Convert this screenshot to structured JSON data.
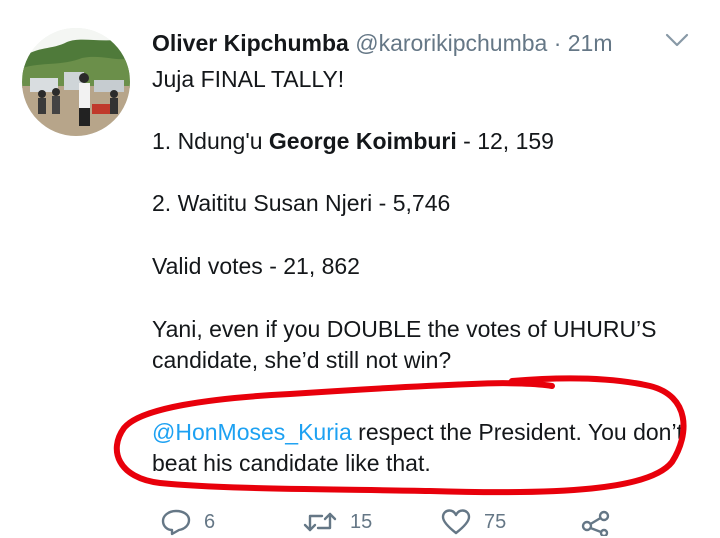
{
  "tweet": {
    "author_name": "Oliver Kipchumba",
    "handle": "@karorikipchumba",
    "separator": "·",
    "time": "21m",
    "menu_icon": "chevron-down-icon",
    "line1": "Juja FINAL TALLY!",
    "line2_prefix": "1. Ndung'u ",
    "line2_bold": "George Koimburi",
    "line2_suffix": " - 12, 159",
    "line3": "2. Waititu Susan Njeri - 5,746",
    "line4": "Valid votes - 21, 862",
    "line5": "Yani, even if you DOUBLE the votes of UHURU’S candidate, she’d still not win?",
    "mention": "@HonMoses_Kuria",
    "line6_rest": " respect the President. You don’t beat his candidate like that."
  },
  "actions": {
    "reply_count": "6",
    "retweet_count": "15",
    "like_count": "75",
    "reply_icon": "reply-icon",
    "retweet_icon": "retweet-icon",
    "like_icon": "heart-icon",
    "share_icon": "share-icon"
  },
  "colors": {
    "mention": "#1da1f2",
    "secondary_text": "#657786",
    "annotation": "#e8000b"
  }
}
